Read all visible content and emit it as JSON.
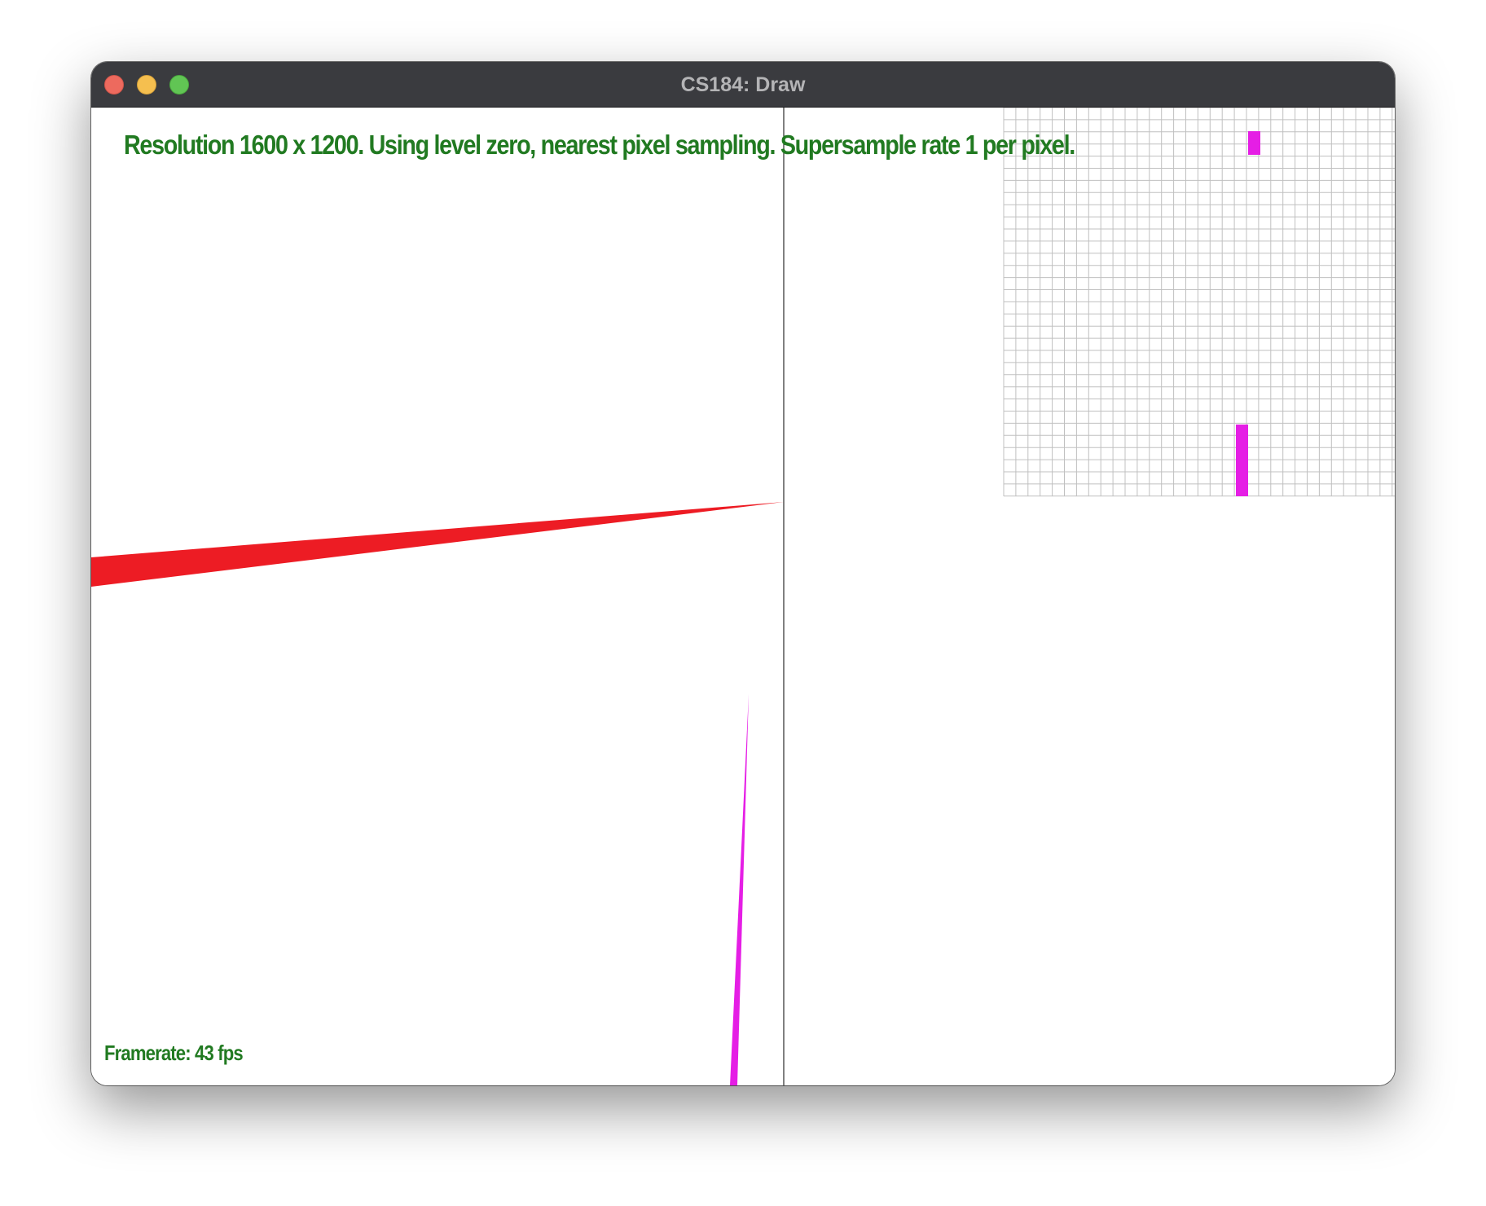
{
  "window": {
    "title": "CS184: Draw",
    "buttons": [
      "close",
      "minimize",
      "zoom"
    ]
  },
  "overlay": {
    "status": "Resolution 1600 x 1200. Using level zero, nearest pixel sampling. Supersample rate 1 per pixel.",
    "framerate": "Framerate: 43 fps"
  },
  "render": {
    "resolution": "1600 x 1200",
    "sampling": "nearest pixel",
    "level": "zero",
    "supersample_rate": 1,
    "fps": 43
  },
  "colors": {
    "text": "#217a21",
    "red_triangle": "#ed1c24",
    "magenta_triangle": "#e51ee5",
    "zoom_grid": "#c0c0c0",
    "divider": "#000000",
    "titlebar": "#3a3b3f"
  }
}
